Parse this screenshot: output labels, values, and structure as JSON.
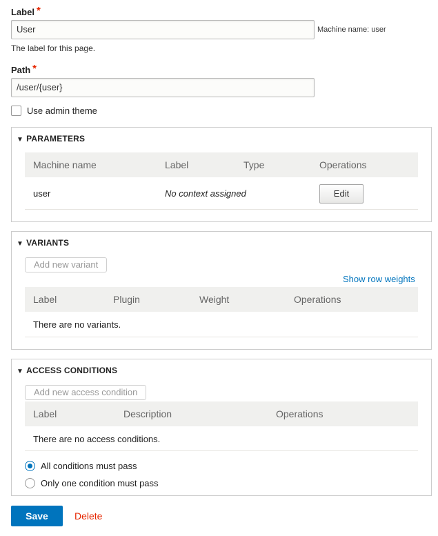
{
  "label_field": {
    "label": "Label",
    "required_marker": "*",
    "value": "User",
    "machine_name": "Machine name: user",
    "description": "The label for this page."
  },
  "path_field": {
    "label": "Path",
    "required_marker": "*",
    "value": "/user/{user}"
  },
  "admin_theme": {
    "label": "Use admin theme",
    "checked": false
  },
  "parameters": {
    "title": "PARAMETERS",
    "columns": [
      "Machine name",
      "Label",
      "Type",
      "Operations"
    ],
    "rows": [
      {
        "machine_name": "user",
        "label": "No context assigned",
        "type": "",
        "operation": "Edit"
      }
    ]
  },
  "variants": {
    "title": "VARIANTS",
    "add_button": "Add new variant",
    "show_weights": "Show row weights",
    "columns": [
      "Label",
      "Plugin",
      "Weight",
      "Operations"
    ],
    "empty": "There are no variants."
  },
  "access_conditions": {
    "title": "ACCESS CONDITIONS",
    "add_button": "Add new access condition",
    "columns": [
      "Label",
      "Description",
      "Operations"
    ],
    "empty": "There are no access conditions.",
    "logic_options": [
      {
        "label": "All conditions must pass",
        "selected": true
      },
      {
        "label": "Only one condition must pass",
        "selected": false
      }
    ]
  },
  "actions": {
    "save": "Save",
    "delete": "Delete"
  },
  "colors": {
    "primary": "#0074bd",
    "required": "#e62600",
    "link": "#0074bd",
    "danger": "#e62600"
  }
}
